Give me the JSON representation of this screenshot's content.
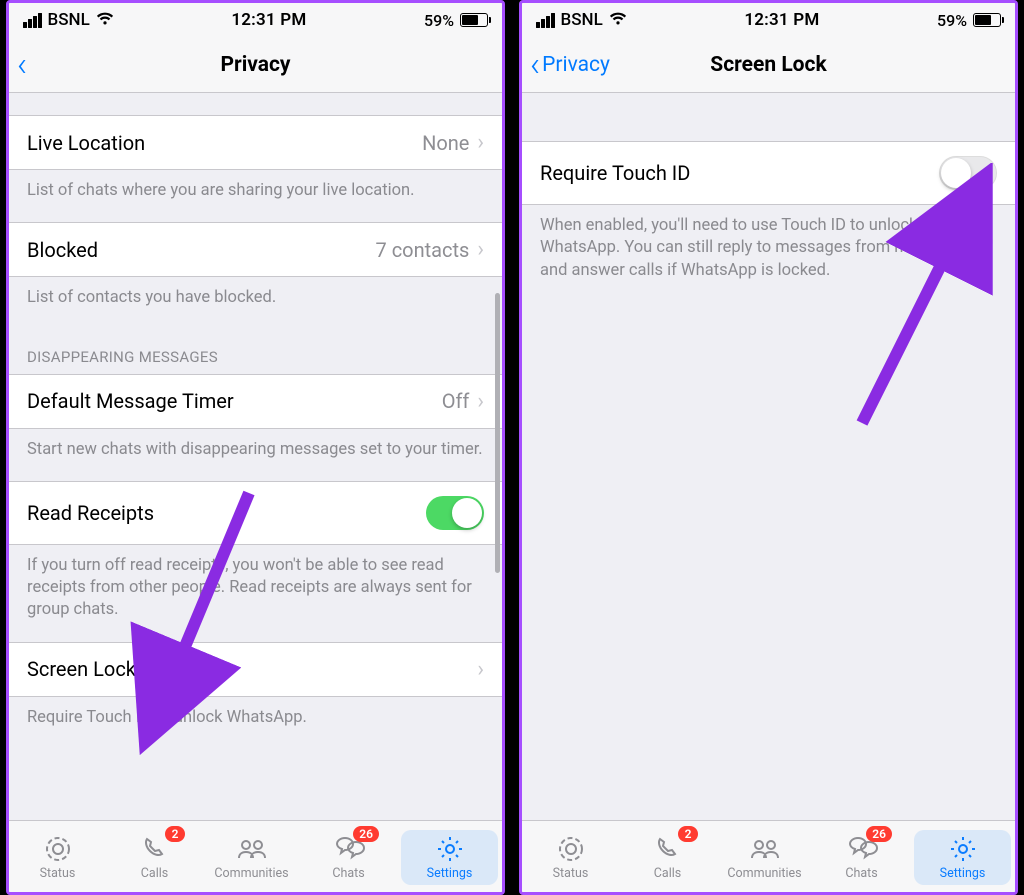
{
  "status": {
    "carrier": "BSNL",
    "time": "12:31 PM",
    "battery_pct": "59%"
  },
  "left": {
    "nav_title": "Privacy",
    "sections": {
      "live_location": {
        "label": "Live Location",
        "value": "None",
        "footer": "List of chats where you are sharing your live location."
      },
      "blocked": {
        "label": "Blocked",
        "value": "7 contacts",
        "footer": "List of contacts you have blocked."
      },
      "disappearing_header": "DISAPPEARING MESSAGES",
      "default_timer": {
        "label": "Default Message Timer",
        "value": "Off",
        "footer": "Start new chats with disappearing messages set to your timer."
      },
      "read_receipts": {
        "label": "Read Receipts",
        "footer": "If you turn off read receipts, you won't be able to see read receipts from other people. Read receipts are always sent for group chats."
      },
      "screen_lock": {
        "label": "Screen Lock",
        "footer": "Require Touch ID to unlock WhatsApp."
      }
    }
  },
  "right": {
    "nav_back": "Privacy",
    "nav_title": "Screen Lock",
    "require_touch_id": {
      "label": "Require Touch ID",
      "footer": "When enabled, you'll need to use Touch ID to unlock WhatsApp. You can still reply to messages from notifications and answer calls if WhatsApp is locked."
    }
  },
  "tabs": {
    "status": "Status",
    "calls": "Calls",
    "calls_badge": "2",
    "communities": "Communities",
    "chats": "Chats",
    "chats_badge": "26",
    "settings": "Settings"
  },
  "colors": {
    "accent": "#007aff",
    "highlight": "#a64eff",
    "toggle_on": "#4cd964"
  }
}
